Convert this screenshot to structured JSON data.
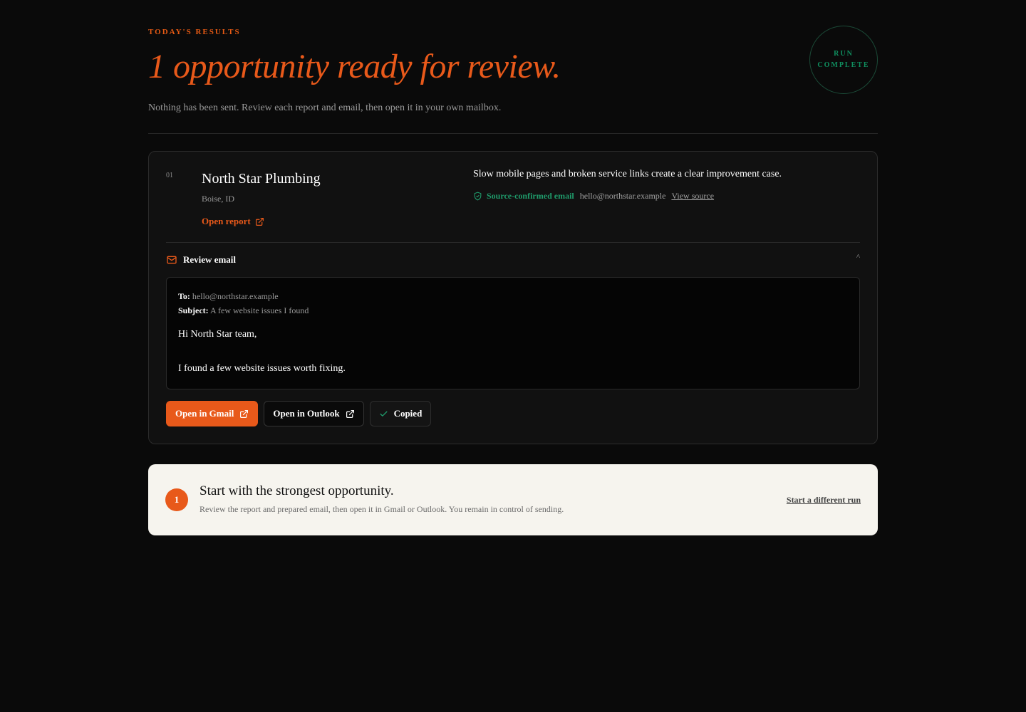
{
  "header": {
    "eyebrow": "Today's results",
    "headline": "1 opportunity ready for review.",
    "subline": "Nothing has been sent. Review each report and email, then open it in your own mailbox.",
    "badge_line1": "Run",
    "badge_line2": "Complete"
  },
  "opportunity": {
    "index": "01",
    "name": "North Star Plumbing",
    "location": "Boise, ID",
    "open_report_label": "Open report",
    "summary": "Slow mobile pages and broken service links create a clear improvement case.",
    "source_label": "Source-confirmed email",
    "source_email": "hello@northstar.example",
    "view_source_label": "View source"
  },
  "review": {
    "title": "Review email",
    "chevron": "^",
    "to_label": "To:",
    "to_value": "hello@northstar.example",
    "subject_label": "Subject:",
    "subject_value": "A few website issues I found",
    "greeting": "Hi North Star team,",
    "body": "I found a few website issues worth fixing."
  },
  "actions": {
    "gmail_label": "Open in Gmail",
    "outlook_label": "Open in Outlook",
    "copied_label": "Copied"
  },
  "next_step": {
    "number": "1",
    "title": "Start with the strongest opportunity.",
    "description": "Review the report and prepared email, then open it in Gmail or Outlook. You remain in control of sending.",
    "link_label": "Start a different run"
  },
  "colors": {
    "accent": "#e8591a",
    "success": "#1f9b6b",
    "background": "#0a0a0a",
    "panel_light": "#f6f4ee"
  }
}
